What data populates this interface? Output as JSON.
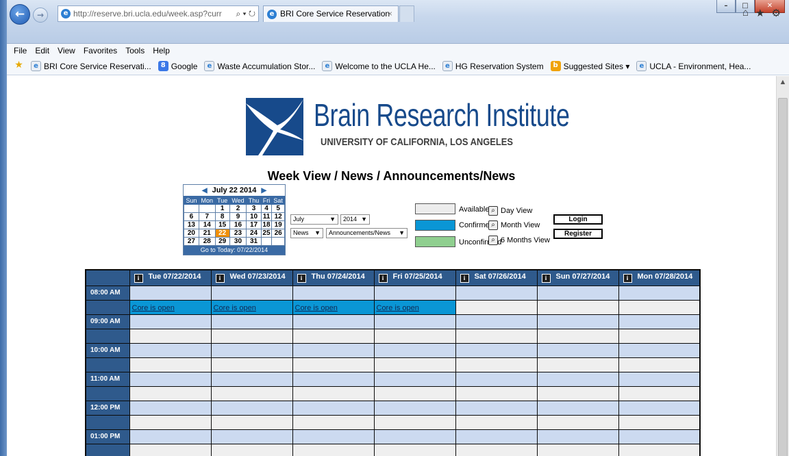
{
  "browser": {
    "address": "http://reserve.bri.ucla.edu/week.asp?curr",
    "address_domain": "ucla.edu",
    "tab_title": "BRI Core Service Reservation",
    "menu": [
      "File",
      "Edit",
      "View",
      "Favorites",
      "Tools",
      "Help"
    ],
    "favorites": [
      {
        "icon": "ie",
        "label": "BRI Core Service Reservati..."
      },
      {
        "icon": "google",
        "label": "Google"
      },
      {
        "icon": "ie",
        "label": "Waste Accumulation Stor..."
      },
      {
        "icon": "ie",
        "label": "Welcome to the UCLA He..."
      },
      {
        "icon": "ie",
        "label": "HG Reservation System"
      },
      {
        "icon": "bing",
        "label": "Suggested Sites ▾"
      },
      {
        "icon": "ie",
        "label": "UCLA - Environment, Hea..."
      }
    ]
  },
  "logo": {
    "title": "Brain Research Institute",
    "subtitle": "UNIVERSITY OF CALIFORNIA, LOS ANGELES"
  },
  "page_title": "Week View / News / Announcements/News",
  "calendar": {
    "month_label": "July 22 2014",
    "weekdays": [
      "Sun",
      "Mon",
      "Tue",
      "Wed",
      "Thu",
      "Fri",
      "Sat"
    ],
    "weeks": [
      [
        "",
        "",
        "1",
        "2",
        "3",
        "4",
        "5"
      ],
      [
        "6",
        "7",
        "8",
        "9",
        "10",
        "11",
        "12"
      ],
      [
        "13",
        "14",
        "15",
        "16",
        "17",
        "18",
        "19"
      ],
      [
        "20",
        "21",
        "22",
        "23",
        "24",
        "25",
        "26"
      ],
      [
        "27",
        "28",
        "29",
        "30",
        "31",
        "",
        ""
      ]
    ],
    "today": "22",
    "footer": "Go to Today: 07/22/2014"
  },
  "selects": {
    "month": "July",
    "year": "2014",
    "category": "News",
    "subcategory": "Announcements/News"
  },
  "legend": {
    "available": "Available",
    "confirmed": "Confirmed",
    "unconfirmed": "Unconfirmed",
    "colors": {
      "available": "#ececec",
      "confirmed": "#0a96d5",
      "unconfirmed": "#8fcf8f"
    }
  },
  "views": {
    "day": "Day View",
    "month": "Month View",
    "six_months": "6 Months View"
  },
  "buttons": {
    "login": "Login",
    "register": "Register"
  },
  "week": {
    "days": [
      "Tue 07/22/2014",
      "Wed 07/23/2014",
      "Thu 07/24/2014",
      "Fri 07/25/2014",
      "Sat 07/26/2014",
      "Sun 07/27/2014",
      "Mon 07/28/2014"
    ],
    "times": [
      "08:00 AM",
      "09:00 AM",
      "10:00 AM",
      "11:00 AM",
      "12:00 PM",
      "01:00 PM"
    ],
    "open_label": "Core is open",
    "open_days": [
      0,
      1,
      2,
      3
    ]
  }
}
